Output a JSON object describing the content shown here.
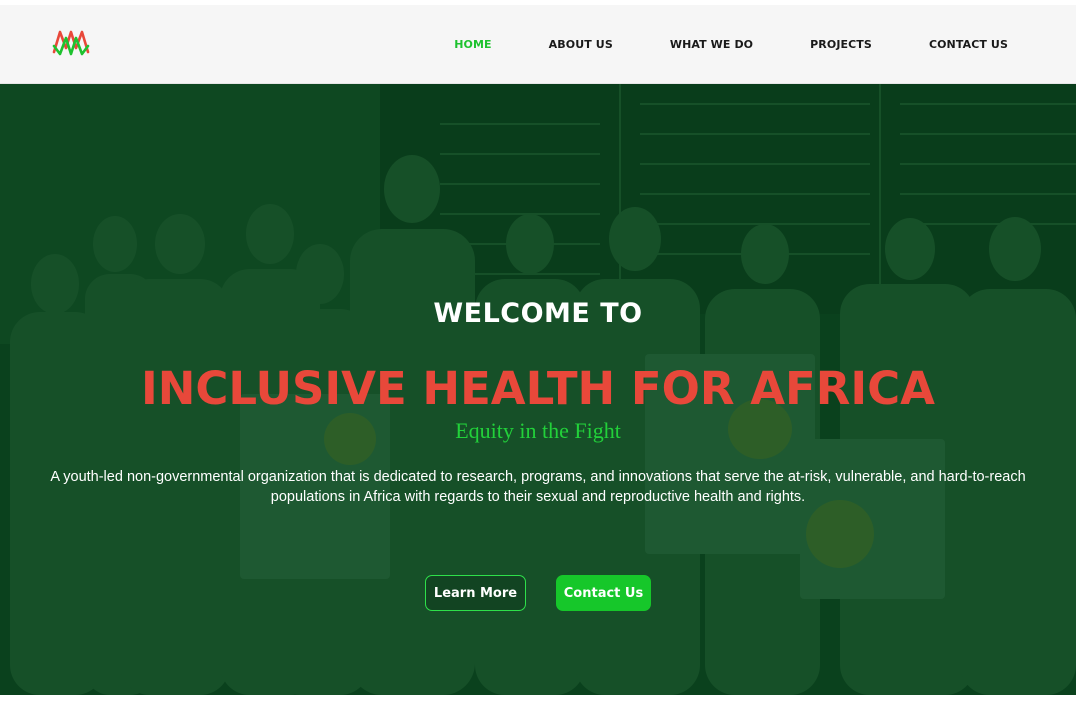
{
  "brand": {
    "logo_icon": "zigzag-wave-logo-icon",
    "colors": {
      "green": "#1ec22f",
      "red": "#e8483a",
      "overlay": "#063a18"
    }
  },
  "nav": {
    "items": [
      {
        "label": "HOME",
        "active": true
      },
      {
        "label": "ABOUT US",
        "active": false
      },
      {
        "label": "WHAT WE DO",
        "active": false
      },
      {
        "label": "PROJECTS",
        "active": false
      },
      {
        "label": "CONTACT US",
        "active": false
      }
    ]
  },
  "hero": {
    "welcome": "WELCOME TO",
    "title": "INCLUSIVE HEALTH FOR AFRICA",
    "tagline": "Equity in the Fight",
    "description": "A youth-led non-governmental organization that is dedicated to research, programs, and innovations that serve the at-risk, vulnerable, and hard-to-reach populations in Africa with regards to their sexual and reproductive health and rights.",
    "buttons": {
      "learn_more": "Learn More",
      "contact_us": "Contact Us"
    },
    "background_image": "group-photo-of-smiling-young-people-holding-posters"
  }
}
